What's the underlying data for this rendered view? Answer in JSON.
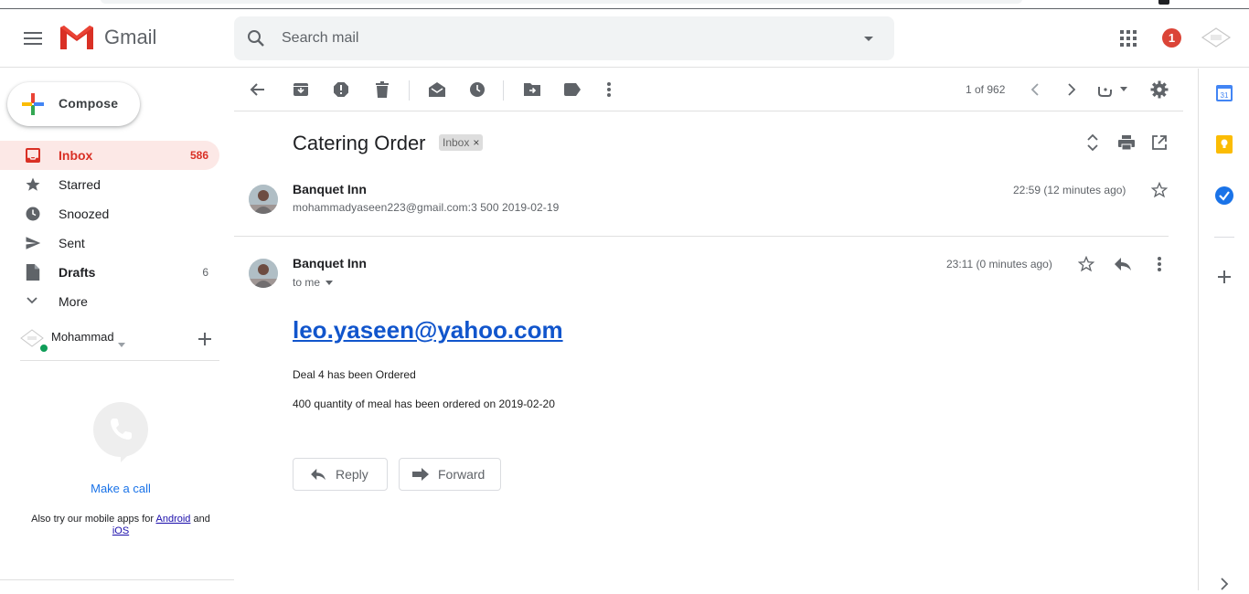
{
  "app": {
    "name": "Gmail"
  },
  "search": {
    "placeholder": "Search mail"
  },
  "header": {
    "notification_count": "1"
  },
  "compose": {
    "label": "Compose"
  },
  "sidebar": {
    "items": [
      {
        "label": "Inbox",
        "count": "586",
        "icon": "inbox-icon"
      },
      {
        "label": "Starred",
        "count": "",
        "icon": "star-icon"
      },
      {
        "label": "Snoozed",
        "count": "",
        "icon": "clock-icon"
      },
      {
        "label": "Sent",
        "count": "",
        "icon": "send-icon"
      },
      {
        "label": "Drafts",
        "count": "6",
        "icon": "draft-icon"
      },
      {
        "label": "More",
        "count": "",
        "icon": "chevron-down-icon"
      }
    ],
    "hangouts_user": "Mohammad",
    "make_call": "Make a call",
    "mobile_prefix": "Also try our mobile apps for",
    "android": "Android",
    "and": "and",
    "ios": "iOS"
  },
  "toolbar": {
    "pager": "1 of 962"
  },
  "thread": {
    "subject": "Catering Order",
    "label": "Inbox",
    "messages": [
      {
        "sender": "Banquet Inn",
        "snippet": "mohammadyaseen223@gmail.com:3 500 2019-02-19",
        "time": "22:59 (12 minutes ago)"
      },
      {
        "sender": "Banquet Inn",
        "to": "to me",
        "time": "23:11 (0 minutes ago)",
        "link": "leo.yaseen@yahoo.com",
        "lines": [
          "Deal 4 has been Ordered",
          "400 quantity of meal has been ordered on 2019-02-20"
        ]
      }
    ],
    "reply_label": "Reply",
    "forward_label": "Forward"
  },
  "colors": {
    "accent_red": "#d93025",
    "link_blue": "#1155cc",
    "inbox_active_bg": "#fce8e6"
  }
}
